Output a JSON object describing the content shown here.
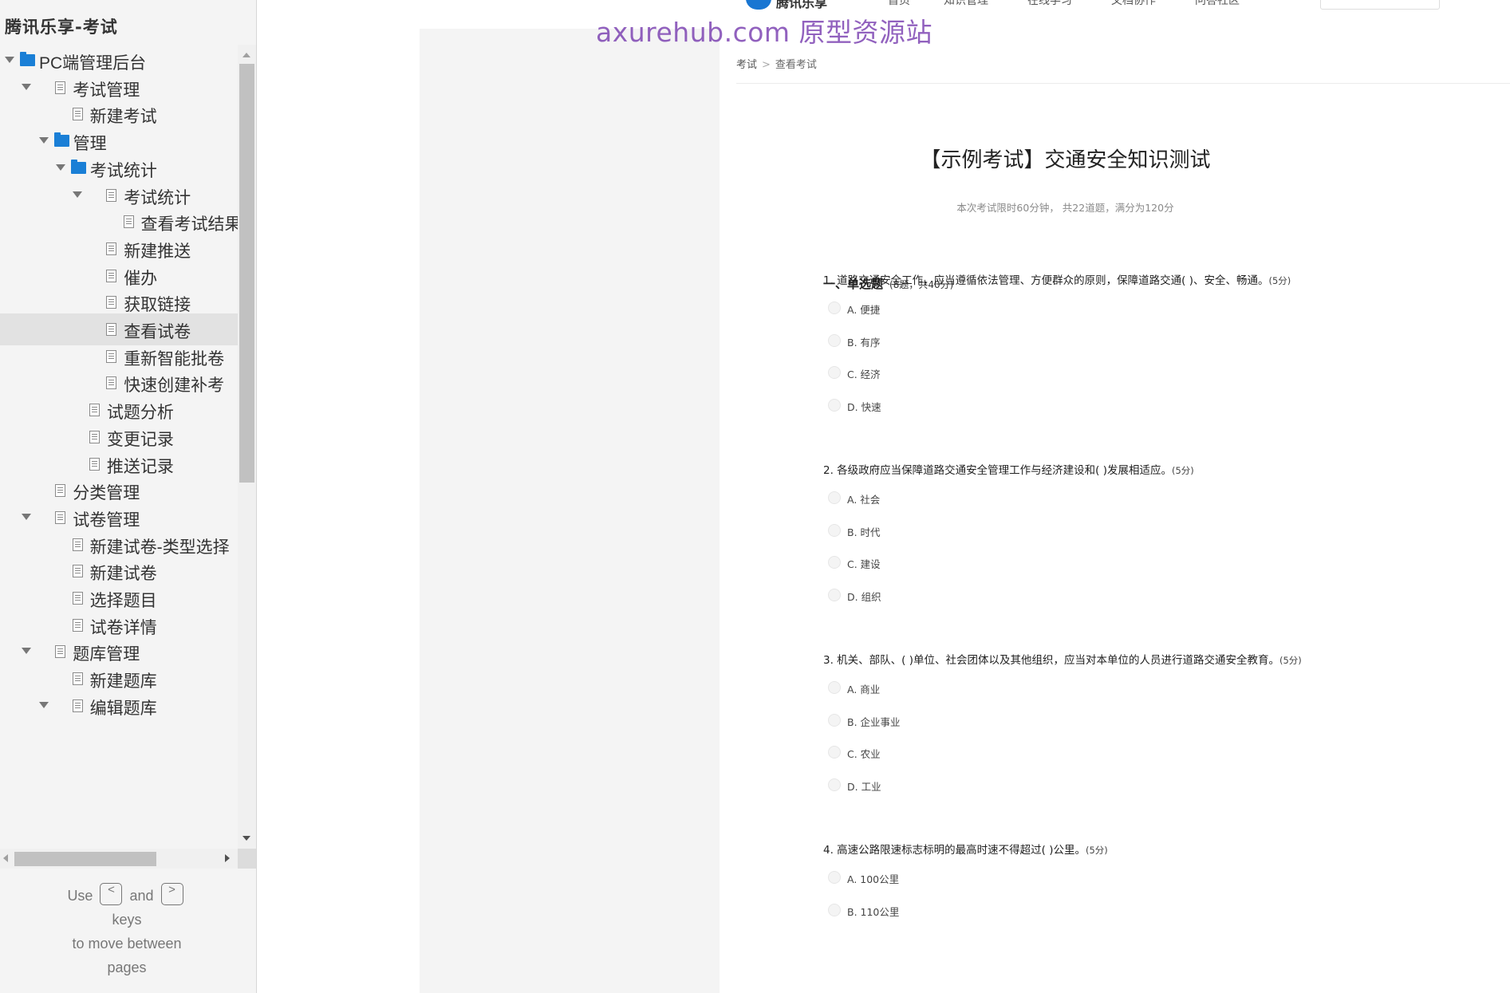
{
  "sidebar": {
    "title": "腾讯乐享-考试",
    "tree": [
      {
        "label": "PC端管理后台",
        "icon": "folder-icon",
        "caret": true
      },
      {
        "label": "考试管理",
        "icon": "page-icon",
        "caret": true
      },
      {
        "label": "新建考试",
        "icon": "page-icon",
        "caret": false
      },
      {
        "label": "管理",
        "icon": "folder-icon",
        "caret": true
      },
      {
        "label": "考试统计",
        "icon": "folder-icon",
        "caret": true
      },
      {
        "label": "考试统计",
        "icon": "page-icon",
        "caret": true
      },
      {
        "label": "查看考试结果",
        "icon": "page-icon",
        "caret": false
      },
      {
        "label": "新建推送",
        "icon": "page-icon",
        "caret": false
      },
      {
        "label": "催办",
        "icon": "page-icon",
        "caret": false
      },
      {
        "label": "获取链接",
        "icon": "page-icon",
        "caret": false
      },
      {
        "label": "查看试卷",
        "icon": "page-icon",
        "caret": false,
        "selected": true
      },
      {
        "label": "重新智能批卷",
        "icon": "page-icon",
        "caret": false
      },
      {
        "label": "快速创建补考",
        "icon": "page-icon",
        "caret": false
      },
      {
        "label": "试题分析",
        "icon": "page-icon",
        "caret": false
      },
      {
        "label": "变更记录",
        "icon": "page-icon",
        "caret": false
      },
      {
        "label": "推送记录",
        "icon": "page-icon",
        "caret": false
      },
      {
        "label": "分类管理",
        "icon": "page-icon",
        "caret": false
      },
      {
        "label": "试卷管理",
        "icon": "page-icon",
        "caret": true
      },
      {
        "label": "新建试卷-类型选择",
        "icon": "page-icon",
        "caret": false
      },
      {
        "label": "新建试卷",
        "icon": "page-icon",
        "caret": false
      },
      {
        "label": "选择题目",
        "icon": "page-icon",
        "caret": false
      },
      {
        "label": "试卷详情",
        "icon": "page-icon",
        "caret": false
      },
      {
        "label": "题库管理",
        "icon": "page-icon",
        "caret": true
      },
      {
        "label": "新建题库",
        "icon": "page-icon",
        "caret": false
      },
      {
        "label": "编辑题库",
        "icon": "page-icon",
        "caret": true
      }
    ],
    "hint": {
      "use": "Use",
      "prev_key": "<",
      "and": "and",
      "next_key": ">",
      "keys": "keys",
      "to_move": "to move between",
      "pages": "pages"
    }
  },
  "watermark": "axurehub.com 原型资源站",
  "topbar": {
    "brand": "腾讯乐享",
    "nav": [
      "首页",
      "知识管理",
      "在线学习",
      "文档协作",
      "问答社区"
    ]
  },
  "breadcrumb": {
    "root": "考试",
    "separator": ">",
    "current": "查看考试"
  },
  "exam": {
    "title": "【示例考试】交通安全知识测试",
    "meta": "本次考试限时60分钟，  共22道题，满分为120分"
  },
  "section": {
    "title": "一、单选题",
    "note": "(8题，共40分)"
  },
  "questions": [
    {
      "text": "1. 道路交通安全工作，应当遵循依法管理、方便群众的原则，保障道路交通(  )、安全、畅通。",
      "score": "(5分)",
      "options": [
        "A. 便捷",
        "B. 有序",
        "C. 经济",
        "D. 快速"
      ]
    },
    {
      "text": "2. 各级政府应当保障道路交通安全管理工作与经济建设和(  )发展相适应。",
      "score": "(5分)",
      "options": [
        "A. 社会",
        "B. 时代",
        "C. 建设",
        "D. 组织"
      ]
    },
    {
      "text": "3. 机关、部队、(  )单位、社会团体以及其他组织，应当对本单位的人员进行道路交通安全教育。",
      "score": "(5分)",
      "options": [
        "A. 商业",
        "B. 企业事业",
        "C. 农业",
        "D. 工业"
      ]
    },
    {
      "text": "4. 高速公路限速标志标明的最高时速不得超过(    )公里。",
      "score": "(5分)",
      "options": [
        "A. 100公里",
        "B. 110公里"
      ]
    }
  ]
}
